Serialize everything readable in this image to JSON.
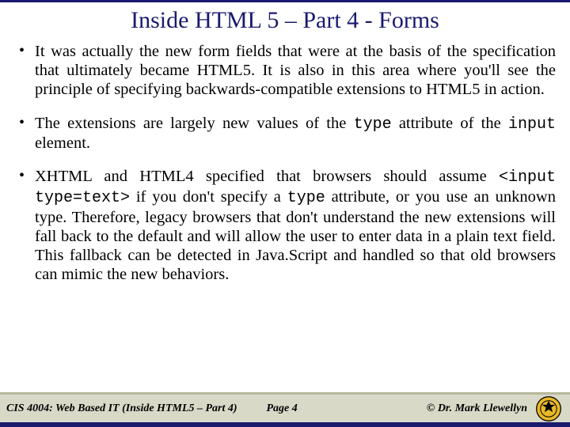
{
  "title": "Inside HTML 5 – Part 4 - Forms",
  "bullets": {
    "b1": "It was actually the new form fields that were at the basis of the specification that ultimately became HTML5. It is also in this area where you'll see the principle of specifying backwards-compatible extensions to HTML5 in action.",
    "b2_pre": "The extensions are largely new values of the ",
    "b2_code1": "type",
    "b2_mid": " attribute of the ",
    "b2_code2": "input",
    "b2_post": " element.",
    "b3_pre": "XHTML and HTML4 specified that browsers should assume ",
    "b3_code1": "<input type=text>",
    "b3_mid1": " if you don't specify a ",
    "b3_code2": "type",
    "b3_post": " attribute, or you use an unknown type. Therefore, legacy browsers that don't understand the new extensions will fall back to the default and will allow the user to enter data in a plain text field. This fallback can be detected in Java.Script and handled so that old browsers can mimic the new behaviors."
  },
  "footer": {
    "left": "CIS 4004: Web Based IT (Inside HTML5 – Part 4)",
    "center": "Page 4",
    "right": "© Dr. Mark Llewellyn"
  }
}
